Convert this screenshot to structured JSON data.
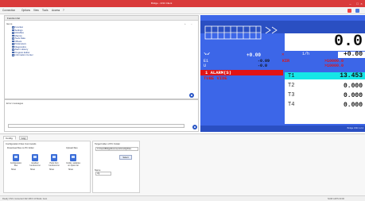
{
  "window": {
    "title": "Bridge - CNC Client",
    "controls": [
      "–",
      "□",
      "×"
    ]
  },
  "menu": {
    "items": [
      "Connection",
      "Options",
      "View",
      "Tools",
      "Access",
      "?"
    ],
    "accent": "#d93a3a"
  },
  "function_list": {
    "header": "Function list",
    "subheader": "Items",
    "controls": [
      "+",
      "–"
    ],
    "items": [
      "Function",
      "Settings",
      "Variables",
      "Macros",
      "Tools Data",
      "Offsets",
      "Parameters",
      "Diagnostics",
      "Alarm History",
      "Program Editor",
      "Information Center"
    ]
  },
  "messages": {
    "label": "Error messages",
    "input_value": ""
  },
  "cnc_screen": {
    "main_value": "0.0",
    "feed_value": "+0.00",
    "feed_unit": "1/h",
    "alarm_text": "1 ALARM(S)",
    "tube_label": "TUBE VIDE",
    "row_e_label": "E1",
    "row_e_value": "-0.09",
    "row_e_code": "KIR",
    "row_e_limit": ">10000.0",
    "row_u_label": "U",
    "row_u_value": "-0.0",
    "row_u_limit": ">10000.0",
    "cyan_value": "13.453",
    "t_values": [
      {
        "label": "T1",
        "value": "13.453"
      },
      {
        "label": "T2",
        "value": "0.000"
      },
      {
        "label": "T3",
        "value": "0.000"
      },
      {
        "label": "T4",
        "value": "0.000"
      }
    ],
    "status_text": "Bridge CNC 1.2.4",
    "colors": {
      "background": "#3c66e8",
      "alarm": "#e01414",
      "highlight": "#16e6e6"
    }
  },
  "bottom_panel": {
    "tabs": [
      "Config. files",
      "Log"
    ],
    "group_title": "Configuration Files Commands",
    "sub_title": "Download files to PC folder",
    "upload_title": "Upload files",
    "tiles": [
      {
        "label": "Configuration files",
        "option": "Show"
      },
      {
        "label": "Enabled functions list",
        "option": "Show"
      },
      {
        "label": "Parts from functions list",
        "option": "Show"
      },
      {
        "label": "Config. variables on option list",
        "option": "Show"
      }
    ],
    "target_title": "Target folder of PC Folder",
    "target_path": "C:\\Users\\Bridge\\Documents\\Config\\Files",
    "select_button": "Select",
    "name_label": "Name",
    "name_value": "cfg"
  },
  "statusbar": {
    "left": "Ready   CNC connected   192.168.0.10   Mode: Auto",
    "right": "NUM   CAPS   00:00"
  }
}
